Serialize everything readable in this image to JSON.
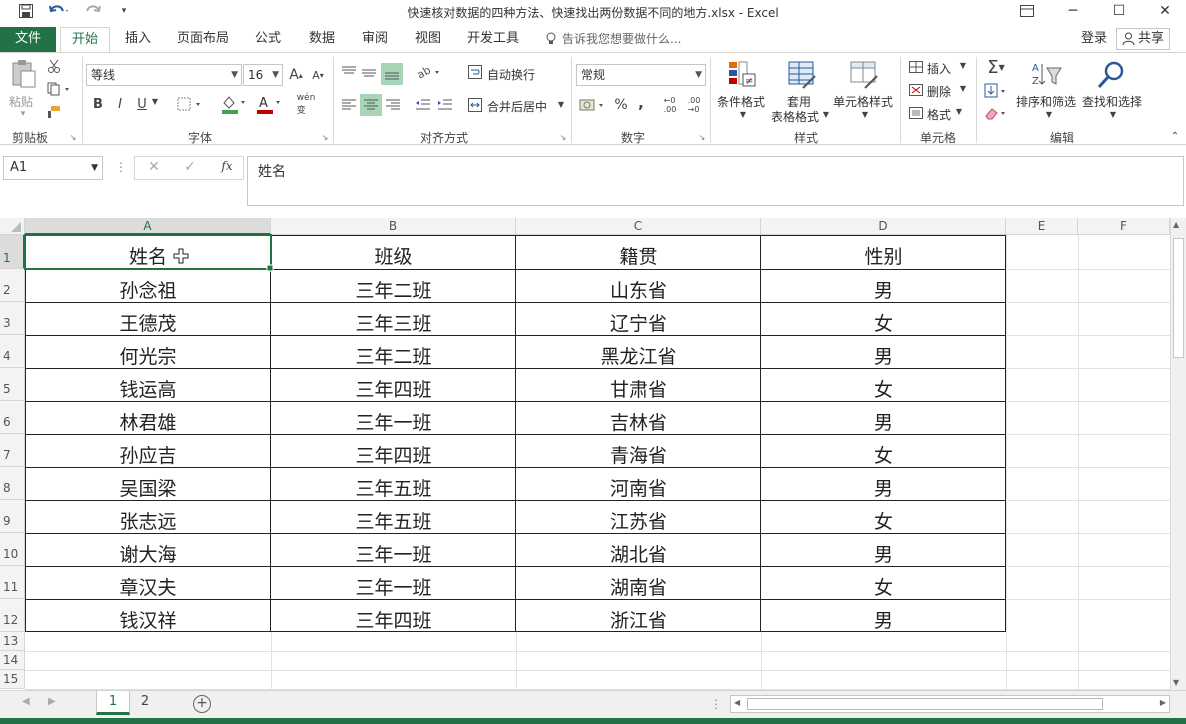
{
  "window": {
    "title": "快速核对数据的四种方法、快速找出两份数据不同的地方.xlsx - Excel",
    "minimize": "─",
    "maximize": "☐",
    "close": "✕"
  },
  "tabs": {
    "file": "文件",
    "home": "开始",
    "insert": "插入",
    "layout": "页面布局",
    "formula": "公式",
    "data": "数据",
    "review": "审阅",
    "view": "视图",
    "developer": "开发工具",
    "tellme": "告诉我您想要做什么...",
    "login": "登录",
    "share": "共享"
  },
  "ribbon": {
    "clipboard": {
      "label": "剪贴板",
      "paste": "粘贴"
    },
    "font": {
      "label": "字体",
      "name": "等线",
      "size": "16",
      "bold": "B",
      "italic": "I",
      "underline": "U"
    },
    "align": {
      "label": "对齐方式",
      "wrap": "自动换行",
      "merge": "合并后居中"
    },
    "number": {
      "label": "数字",
      "format": "常规",
      "percent": "%",
      "comma": ","
    },
    "styles": {
      "label": "样式",
      "cond": "条件格式",
      "table1": "套用",
      "table2": "表格格式",
      "cell": "单元格样式"
    },
    "cells": {
      "label": "单元格",
      "insert": "插入",
      "delete": "删除",
      "format": "格式"
    },
    "edit": {
      "label": "编辑",
      "sort": "排序和筛选",
      "find": "查找和选择"
    }
  },
  "formula_bar": {
    "name_box": "A1",
    "fx": "fx",
    "content": "姓名"
  },
  "columns": [
    "A",
    "B",
    "C",
    "D",
    "E",
    "F"
  ],
  "rows": [
    "1",
    "2",
    "3",
    "4",
    "5",
    "6",
    "7",
    "8",
    "9",
    "10",
    "11",
    "12",
    "13",
    "14",
    "15"
  ],
  "table": {
    "headers": [
      "姓名",
      "班级",
      "籍贯",
      "性别"
    ],
    "data": [
      [
        "孙念祖",
        "三年二班",
        "山东省",
        "男"
      ],
      [
        "王德茂",
        "三年三班",
        "辽宁省",
        "女"
      ],
      [
        "何光宗",
        "三年二班",
        "黑龙江省",
        "男"
      ],
      [
        "钱运高",
        "三年四班",
        "甘肃省",
        "女"
      ],
      [
        "林君雄",
        "三年一班",
        "吉林省",
        "男"
      ],
      [
        "孙应吉",
        "三年四班",
        "青海省",
        "女"
      ],
      [
        "吴国梁",
        "三年五班",
        "河南省",
        "男"
      ],
      [
        "张志远",
        "三年五班",
        "江苏省",
        "女"
      ],
      [
        "谢大海",
        "三年一班",
        "湖北省",
        "男"
      ],
      [
        "章汉夫",
        "三年一班",
        "湖南省",
        "女"
      ],
      [
        "钱汉祥",
        "三年四班",
        "浙江省",
        "男"
      ]
    ]
  },
  "sheets": [
    "1",
    "2"
  ],
  "colors": {
    "accent": "#217346",
    "selection": "#217346"
  }
}
